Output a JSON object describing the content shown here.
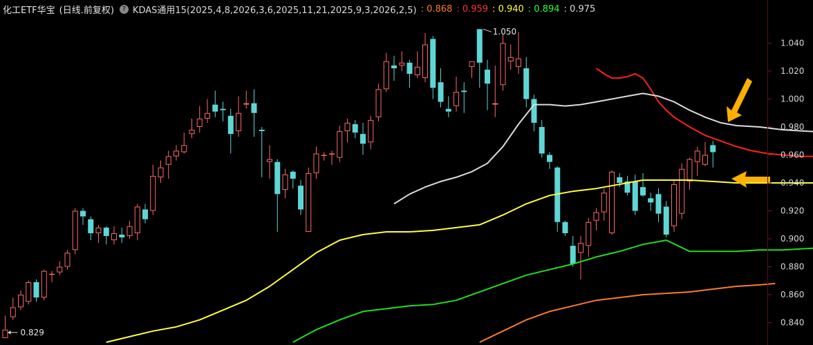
{
  "header": {
    "title": "化工ETF华宝",
    "period": "(日线.前复权)",
    "indicator_name": "KDAS通用15(2025,4,8,2026,3,6,2025,11,21,2025,9,3,2026,2,5)",
    "indicator_values": [
      {
        "text": ": 0.868",
        "color": "#ff7a2a"
      },
      {
        "text": ": 0.959",
        "color": "#ff3030"
      },
      {
        "text": ": 0.940",
        "color": "#ffff40"
      },
      {
        "text": ": 0.894",
        "color": "#30ff30"
      },
      {
        "text": ": 0.975",
        "color": "#dcdcdc"
      }
    ]
  },
  "colors": {
    "up": "#ff6a6a",
    "down": "#5fd6d6",
    "line_orange": "#ff7a2a",
    "line_red": "#ff2020",
    "line_yellow": "#ffff40",
    "line_green": "#22dd22",
    "line_gray": "#c8c8c8",
    "axis_text": "#d8d8d8",
    "arrow": "#ffb000"
  },
  "chart_data": {
    "type": "candlestick",
    "ylim": [
      0.826,
      1.058
    ],
    "y_ticks": [
      "1.040",
      "1.020",
      "1.000",
      "0.980",
      "0.960",
      "0.940",
      "0.920",
      "0.900",
      "0.880",
      "0.860",
      "0.840"
    ],
    "annotations": {
      "high_label": "1.050",
      "low_label": "0.829"
    },
    "candles": [
      [
        0.829,
        0.835,
        0.829,
        0.845
      ],
      [
        0.844,
        0.851,
        0.842,
        0.858
      ],
      [
        0.851,
        0.86,
        0.849,
        0.863
      ],
      [
        0.855,
        0.869,
        0.853,
        0.87
      ],
      [
        0.869,
        0.858,
        0.855,
        0.871
      ],
      [
        0.858,
        0.877,
        0.856,
        0.878
      ],
      [
        0.875,
        0.875,
        0.869,
        0.877
      ],
      [
        0.876,
        0.88,
        0.874,
        0.884
      ],
      [
        0.88,
        0.89,
        0.878,
        0.892
      ],
      [
        0.892,
        0.92,
        0.889,
        0.922
      ],
      [
        0.92,
        0.916,
        0.91,
        0.922
      ],
      [
        0.914,
        0.904,
        0.899,
        0.916
      ],
      [
        0.904,
        0.908,
        0.897,
        0.91
      ],
      [
        0.908,
        0.902,
        0.896,
        0.909
      ],
      [
        0.899,
        0.904,
        0.896,
        0.909
      ],
      [
        0.903,
        0.901,
        0.897,
        0.908
      ],
      [
        0.902,
        0.909,
        0.9,
        0.913
      ],
      [
        0.904,
        0.923,
        0.899,
        0.925
      ],
      [
        0.921,
        0.914,
        0.911,
        0.925
      ],
      [
        0.92,
        0.945,
        0.917,
        0.953
      ],
      [
        0.944,
        0.951,
        0.94,
        0.956
      ],
      [
        0.953,
        0.959,
        0.943,
        0.963
      ],
      [
        0.959,
        0.963,
        0.956,
        0.967
      ],
      [
        0.962,
        0.967,
        0.961,
        0.976
      ],
      [
        0.975,
        0.978,
        0.972,
        0.986
      ],
      [
        0.98,
        0.986,
        0.976,
        0.995
      ],
      [
        0.986,
        0.99,
        0.983,
        1.0
      ],
      [
        0.996,
        0.991,
        0.987,
        1.006
      ],
      [
        0.993,
        0.992,
        0.984,
        0.998
      ],
      [
        0.988,
        0.975,
        0.961,
        0.993
      ],
      [
        0.977,
        0.99,
        0.973,
        1.002
      ],
      [
        0.996,
        0.997,
        0.993,
        1.006
      ],
      [
        0.997,
        0.99,
        0.973,
        1.007
      ],
      [
        0.978,
        0.977,
        0.944,
        0.98
      ],
      [
        0.955,
        0.957,
        0.943,
        0.967
      ],
      [
        0.955,
        0.932,
        0.905,
        0.957
      ],
      [
        0.935,
        0.946,
        0.929,
        0.95
      ],
      [
        0.948,
        0.943,
        0.936,
        0.949
      ],
      [
        0.938,
        0.921,
        0.917,
        0.942
      ],
      [
        0.905,
        0.947,
        0.905,
        0.951
      ],
      [
        0.947,
        0.961,
        0.943,
        0.966
      ],
      [
        0.96,
        0.96,
        0.956,
        0.962
      ],
      [
        0.961,
        0.961,
        0.953,
        0.963
      ],
      [
        0.958,
        0.977,
        0.955,
        0.981
      ],
      [
        0.977,
        0.983,
        0.969,
        0.986
      ],
      [
        0.982,
        0.976,
        0.972,
        0.985
      ],
      [
        0.975,
        0.968,
        0.96,
        0.983
      ],
      [
        0.969,
        0.985,
        0.964,
        0.988
      ],
      [
        0.987,
        1.007,
        0.984,
        1.011
      ],
      [
        1.007,
        1.027,
        1.005,
        1.033
      ],
      [
        1.024,
        1.022,
        1.013,
        1.031
      ],
      [
        1.024,
        1.026,
        1.02,
        1.034
      ],
      [
        1.026,
        1.018,
        1.008,
        1.028
      ],
      [
        1.017,
        1.023,
        1.015,
        1.034
      ],
      [
        1.015,
        1.039,
        1.012,
        1.047
      ],
      [
        1.043,
        1.008,
        1.0,
        1.045
      ],
      [
        1.012,
        0.998,
        0.994,
        1.022
      ],
      [
        0.993,
        0.991,
        0.987,
        1.002
      ],
      [
        0.995,
        1.005,
        0.991,
        1.016
      ],
      [
        1.006,
        1.005,
        0.99,
        1.012
      ],
      [
        1.023,
        1.027,
        1.015,
        1.027
      ],
      [
        1.05,
        1.026,
        1.008,
        1.05
      ],
      [
        1.021,
        1.011,
        0.992,
        1.028
      ],
      [
        0.996,
        0.997,
        0.987,
        1.024
      ],
      [
        1.01,
        1.04,
        1.006,
        1.046
      ],
      [
        1.027,
        1.03,
        1.021,
        1.039
      ],
      [
        1.023,
        1.029,
        1.018,
        1.048
      ],
      [
        1.022,
        1.0,
        0.994,
        1.03
      ],
      [
        1.0,
        0.983,
        0.977,
        1.003
      ],
      [
        0.98,
        0.961,
        0.958,
        0.985
      ],
      [
        0.96,
        0.955,
        0.95,
        0.962
      ],
      [
        0.951,
        0.912,
        0.905,
        0.952
      ],
      [
        0.912,
        0.904,
        0.902,
        0.913
      ],
      [
        0.895,
        0.882,
        0.88,
        0.902
      ],
      [
        0.89,
        0.897,
        0.871,
        0.902
      ],
      [
        0.895,
        0.912,
        0.887,
        0.915
      ],
      [
        0.913,
        0.919,
        0.906,
        0.922
      ],
      [
        0.919,
        0.933,
        0.913,
        0.936
      ],
      [
        0.904,
        0.948,
        0.903,
        0.949
      ],
      [
        0.944,
        0.94,
        0.937,
        0.947
      ],
      [
        0.941,
        0.933,
        0.931,
        0.945
      ],
      [
        0.941,
        0.92,
        0.917,
        0.946
      ],
      [
        0.937,
        0.931,
        0.93,
        0.947
      ],
      [
        0.929,
        0.926,
        0.92,
        0.933
      ],
      [
        0.932,
        0.918,
        0.912,
        0.936
      ],
      [
        0.923,
        0.903,
        0.901,
        0.927
      ],
      [
        0.909,
        0.939,
        0.905,
        0.942
      ],
      [
        0.918,
        0.95,
        0.914,
        0.954
      ],
      [
        0.941,
        0.957,
        0.935,
        0.958
      ],
      [
        0.955,
        0.963,
        0.945,
        0.966
      ],
      [
        0.953,
        0.96,
        0.952,
        0.969
      ],
      [
        0.967,
        0.962,
        0.951,
        0.97
      ]
    ],
    "series": [
      {
        "name": "0.868",
        "color": "#ff7a2a",
        "points": [
          [
            61,
            0.826
          ],
          [
            64,
            0.834
          ],
          [
            67,
            0.842
          ],
          [
            70,
            0.848
          ],
          [
            73,
            0.852
          ],
          [
            76,
            0.856
          ],
          [
            79,
            0.858
          ],
          [
            82,
            0.86
          ],
          [
            85,
            0.861
          ],
          [
            88,
            0.862
          ],
          [
            91,
            0.864
          ],
          [
            94,
            0.866
          ],
          [
            97,
            0.867
          ],
          [
            99,
            0.868
          ]
        ]
      },
      {
        "name": "0.959",
        "color": "#ff2020",
        "points": [
          [
            76,
            1.022
          ],
          [
            77,
            1.018
          ],
          [
            78,
            1.015
          ],
          [
            79,
            1.015
          ],
          [
            80,
            1.016
          ],
          [
            81,
            1.018
          ],
          [
            82,
            1.015
          ],
          [
            83,
            1.007
          ],
          [
            84,
            0.998
          ],
          [
            85,
            0.992
          ],
          [
            86,
            0.987
          ],
          [
            88,
            0.98
          ],
          [
            90,
            0.974
          ],
          [
            92,
            0.97
          ],
          [
            94,
            0.966
          ],
          [
            96,
            0.963
          ],
          [
            98,
            0.961
          ],
          [
            100,
            0.96
          ],
          [
            102,
            0.959
          ],
          [
            104,
            0.959
          ],
          [
            106,
            0.958
          ],
          [
            108,
            0.958
          ],
          [
            110,
            0.958
          ],
          [
            111,
            0.958
          ],
          [
            112,
            0.959
          ]
        ]
      },
      {
        "name": "0.940",
        "color": "#ffff40",
        "points": [
          [
            13,
            0.826
          ],
          [
            16,
            0.83
          ],
          [
            19,
            0.834
          ],
          [
            22,
            0.837
          ],
          [
            25,
            0.842
          ],
          [
            28,
            0.849
          ],
          [
            31,
            0.856
          ],
          [
            34,
            0.866
          ],
          [
            37,
            0.878
          ],
          [
            40,
            0.89
          ],
          [
            43,
            0.899
          ],
          [
            46,
            0.903
          ],
          [
            49,
            0.905
          ],
          [
            52,
            0.905
          ],
          [
            55,
            0.906
          ],
          [
            58,
            0.908
          ],
          [
            61,
            0.91
          ],
          [
            64,
            0.917
          ],
          [
            67,
            0.925
          ],
          [
            70,
            0.931
          ],
          [
            73,
            0.934
          ],
          [
            76,
            0.936
          ],
          [
            79,
            0.939
          ],
          [
            82,
            0.942
          ],
          [
            85,
            0.942
          ],
          [
            88,
            0.942
          ],
          [
            91,
            0.941
          ],
          [
            94,
            0.94
          ],
          [
            97,
            0.94
          ],
          [
            100,
            0.94
          ],
          [
            103,
            0.94
          ],
          [
            106,
            0.94
          ],
          [
            109,
            0.94
          ],
          [
            112,
            0.94
          ]
        ]
      },
      {
        "name": "0.894",
        "color": "#22dd22",
        "points": [
          [
            37,
            0.826
          ],
          [
            40,
            0.835
          ],
          [
            43,
            0.842
          ],
          [
            46,
            0.848
          ],
          [
            49,
            0.85
          ],
          [
            52,
            0.852
          ],
          [
            55,
            0.853
          ],
          [
            58,
            0.856
          ],
          [
            61,
            0.862
          ],
          [
            64,
            0.868
          ],
          [
            67,
            0.874
          ],
          [
            70,
            0.878
          ],
          [
            73,
            0.882
          ],
          [
            76,
            0.887
          ],
          [
            79,
            0.891
          ],
          [
            82,
            0.896
          ],
          [
            85,
            0.899
          ],
          [
            88,
            0.891
          ],
          [
            91,
            0.891
          ],
          [
            94,
            0.891
          ],
          [
            97,
            0.892
          ],
          [
            100,
            0.892
          ],
          [
            103,
            0.893
          ],
          [
            106,
            0.894
          ],
          [
            109,
            0.894
          ],
          [
            112,
            0.895
          ]
        ]
      },
      {
        "name": "0.975",
        "color": "#dcdcdc",
        "points": [
          [
            50,
            0.925
          ],
          [
            52,
            0.932
          ],
          [
            54,
            0.937
          ],
          [
            56,
            0.941
          ],
          [
            58,
            0.944
          ],
          [
            60,
            0.948
          ],
          [
            62,
            0.954
          ],
          [
            64,
            0.966
          ],
          [
            66,
            0.982
          ],
          [
            68,
            0.996
          ],
          [
            70,
            0.996
          ],
          [
            72,
            0.995
          ],
          [
            74,
            0.996
          ],
          [
            76,
            0.998
          ],
          [
            78,
            1.0
          ],
          [
            80,
            1.002
          ],
          [
            82,
            1.004
          ],
          [
            84,
            1.002
          ],
          [
            86,
            0.998
          ],
          [
            88,
            0.992
          ],
          [
            90,
            0.987
          ],
          [
            92,
            0.983
          ],
          [
            94,
            0.981
          ],
          [
            97,
            0.98
          ],
          [
            100,
            0.978
          ],
          [
            103,
            0.977
          ],
          [
            106,
            0.976
          ],
          [
            109,
            0.976
          ],
          [
            112,
            0.975
          ]
        ]
      }
    ]
  }
}
